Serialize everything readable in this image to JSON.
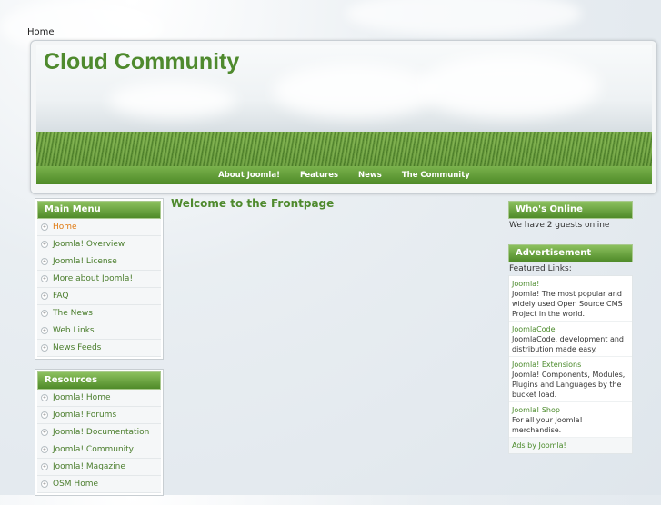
{
  "breadcrumb": "Home",
  "site_title": "Cloud Community",
  "nav": [
    "About Joomla!",
    "Features",
    "News",
    "The Community"
  ],
  "main_menu": {
    "title": "Main Menu",
    "items": [
      "Home",
      "Joomla! Overview",
      "Joomla! License",
      "More about Joomla!",
      "FAQ",
      "The News",
      "Web Links",
      "News Feeds"
    ],
    "active": "Home"
  },
  "resources": {
    "title": "Resources",
    "items": [
      "Joomla! Home",
      "Joomla! Forums",
      "Joomla! Documentation",
      "Joomla! Community",
      "Joomla! Magazine",
      "OSM Home"
    ]
  },
  "main": {
    "title": "Welcome to the Frontpage"
  },
  "whos_online": {
    "title": "Who's Online",
    "text": "We have 2 guests online"
  },
  "advertisement": {
    "title": "Advertisement",
    "intro": "Featured Links:",
    "ads": [
      {
        "link": "Joomla!",
        "text": "Joomla! The most popular and widely used Open Source CMS Project in the world."
      },
      {
        "link": "JoomlaCode",
        "text": "JoomlaCode, development and distribution made easy."
      },
      {
        "link": "Joomla! Extensions",
        "text": "Joomla! Components, Modules, Plugins and Languages by the bucket load."
      },
      {
        "link": "Joomla! Shop",
        "text": "For all your Joomla! merchandise."
      }
    ],
    "footer": "Ads by Joomla!"
  },
  "colors": {
    "accent": "#4f8a2e",
    "active": "#e07a12"
  }
}
